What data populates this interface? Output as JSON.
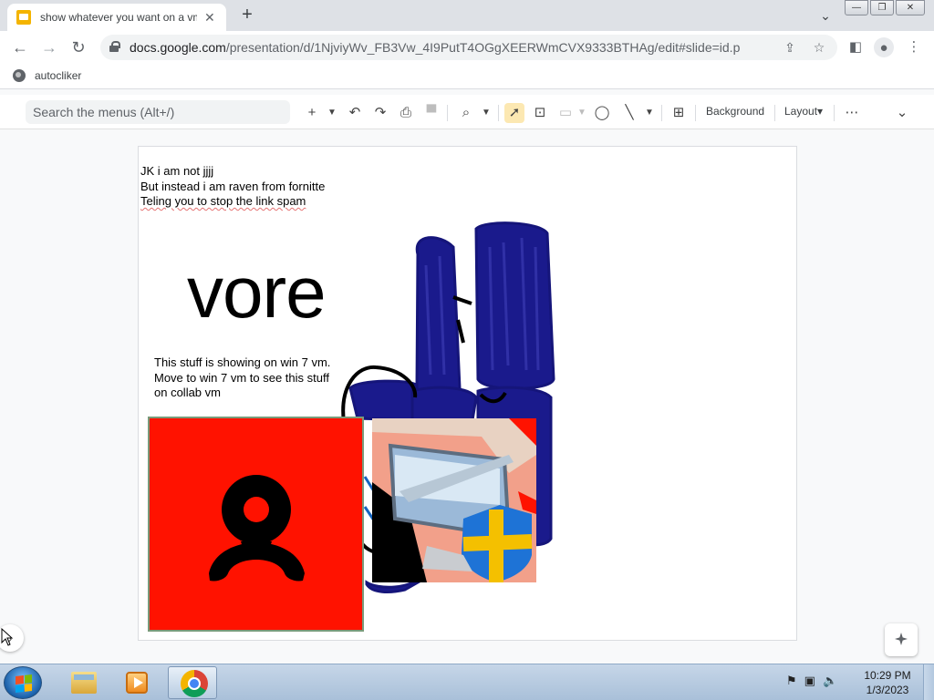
{
  "browser": {
    "tab_title": "show whatever you want on a vm",
    "tab_close": "✕",
    "new_tab": "+",
    "tab_search": "⌄",
    "url_host": "docs.google.com",
    "url_path": "/presentation/d/1NjviyWv_FB3Vw_4I9PutT4OGgXEERWmCVX9333BTHAg/edit#slide=id.p",
    "bookmark": "autocliker",
    "icons": [
      "back-icon",
      "forward-icon",
      "reload-icon",
      "lock-icon",
      "share-icon",
      "star-icon",
      "side-panel-icon",
      "profile-icon",
      "kebab-icon"
    ]
  },
  "window_buttons": {
    "minimize": "—",
    "restore": "❐",
    "close": "✕"
  },
  "slides_toolbar": {
    "search_placeholder": "Search the menus (Alt+/)",
    "background_label": "Background",
    "layout_label": "Layout▾",
    "more": "⋯",
    "collapse": "⌄"
  },
  "slide": {
    "text_block_1": [
      "JK i am not jjjj",
      "But instead i am raven from fornitte",
      "Teling you to stop the link spam"
    ],
    "big_word": "vore",
    "text_block_2": [
      "This stuff is showing on win 7 vm.",
      "Move to win 7 vm to see this stuff",
      "on collab vm"
    ]
  },
  "taskbar": {
    "time": "10:29 PM",
    "date": "1/3/2023",
    "apps": [
      "windows-explorer",
      "windows-media-player",
      "google-chrome"
    ]
  },
  "colors": {
    "red_box": "#ff1200",
    "scribble_blue": "#1a1a8c",
    "slides_accent": "#f4b400"
  }
}
